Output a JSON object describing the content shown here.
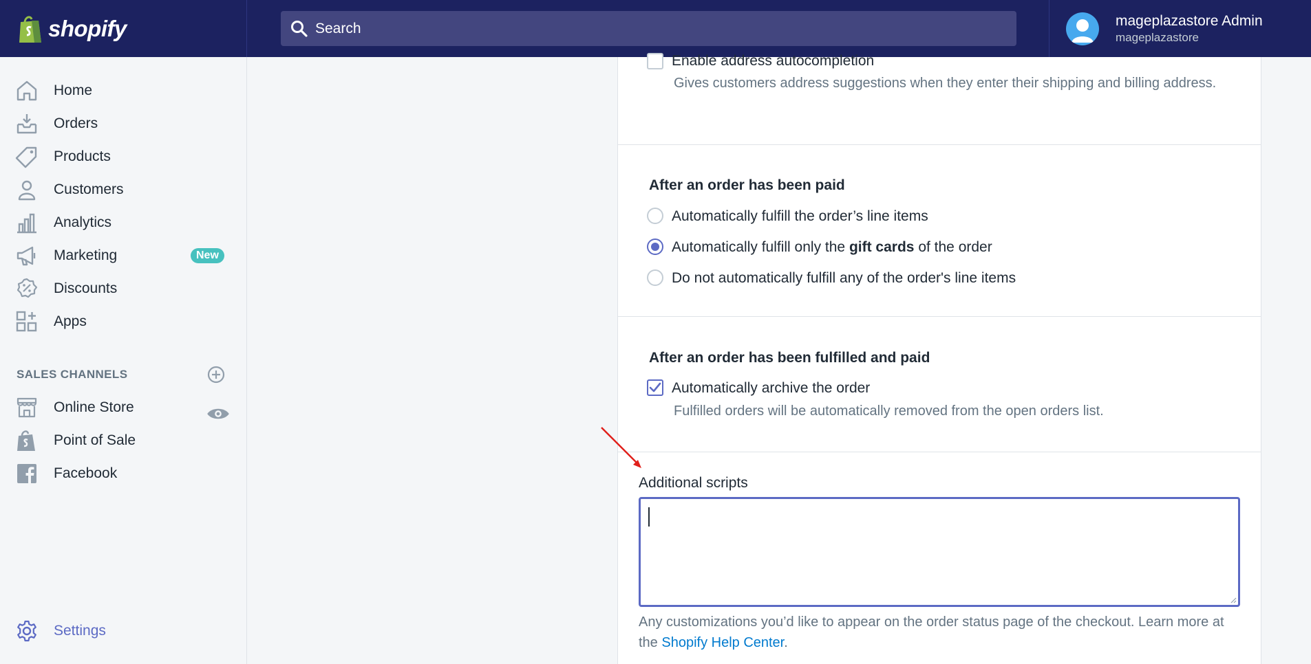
{
  "topbar": {
    "logo_text": "shopify",
    "search_placeholder": "Search",
    "account_name": "mageplazastore Admin",
    "account_store": "mageplazastore"
  },
  "sidebar": {
    "items": [
      {
        "label": "Home",
        "icon": "home-icon"
      },
      {
        "label": "Orders",
        "icon": "orders-icon"
      },
      {
        "label": "Products",
        "icon": "tag-icon"
      },
      {
        "label": "Customers",
        "icon": "person-icon"
      },
      {
        "label": "Analytics",
        "icon": "bar-chart-icon"
      },
      {
        "label": "Marketing",
        "icon": "megaphone-icon",
        "badge": "New"
      },
      {
        "label": "Discounts",
        "icon": "discount-icon"
      },
      {
        "label": "Apps",
        "icon": "apps-icon"
      }
    ],
    "sales_channels_heading": "SALES CHANNELS",
    "channels": [
      {
        "label": "Online Store",
        "icon": "store-icon"
      },
      {
        "label": "Point of Sale",
        "icon": "shopify-bag-icon"
      },
      {
        "label": "Facebook",
        "icon": "facebook-icon"
      }
    ],
    "settings_label": "Settings"
  },
  "main": {
    "autocomplete": {
      "label": "Enable address autocompletion",
      "checked": false,
      "help": "Gives customers address suggestions when they enter their shipping and billing address."
    },
    "after_paid": {
      "title": "After an order has been paid",
      "options": [
        {
          "label": "Automatically fulfill the order’s line items",
          "checked": false
        },
        {
          "label_prefix": "Automatically fulfill only the ",
          "label_bold": "gift cards",
          "label_suffix": " of the order",
          "checked": true
        },
        {
          "label": "Do not automatically fulfill any of the order's line items",
          "checked": false
        }
      ]
    },
    "after_fulfilled": {
      "title": "After an order has been fulfilled and paid",
      "checkbox_label": "Automatically archive the order",
      "checked": true,
      "help": "Fulfilled orders will be automatically removed from the open orders list."
    },
    "scripts": {
      "label": "Additional scripts",
      "value": "",
      "help_prefix": "Any customizations you’d like to appear on the order status page of the checkout. Learn more at the ",
      "help_link": "Shopify Help Center",
      "help_suffix": "."
    }
  },
  "colors": {
    "topbar": "#1c2260",
    "accent": "#5c6ac4",
    "badge": "#47c1bf",
    "link": "#007ace",
    "annotation_arrow": "#e0201b"
  }
}
